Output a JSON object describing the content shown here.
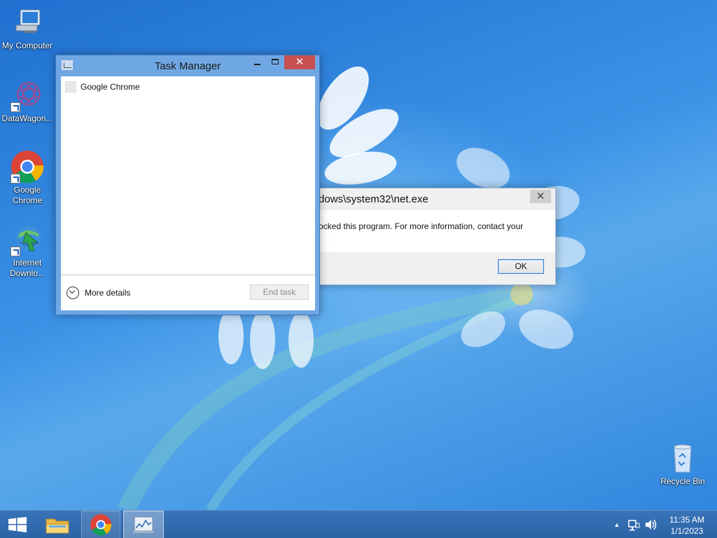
{
  "desktop": {
    "icons": [
      {
        "label": "My Computer"
      },
      {
        "label": "DataWagon..."
      },
      {
        "label": "Google Chrome"
      },
      {
        "label": "Internet Downlo..."
      },
      {
        "label": "Recycle Bin"
      }
    ]
  },
  "error_dialog": {
    "title": "dows\\system32\\net.exe",
    "message": "ocked this program. For more information, contact your",
    "ok_label": "OK",
    "close_glyph": "✕"
  },
  "task_manager": {
    "title": "Task Manager",
    "close_glyph": "✕",
    "processes": [
      {
        "name": "Google Chrome"
      }
    ],
    "more_details_label": "More details",
    "end_task_label": "End task"
  },
  "taskbar": {
    "pinned": [
      "start-button",
      "file-explorer",
      "google-chrome",
      "task-manager"
    ],
    "tray_up_glyph": "▲",
    "clock": {
      "time": "11:35 AM",
      "date": "1/1/2023"
    }
  },
  "colors": {
    "wallpaper": "#2f86dd",
    "taskbar": "#2b63a6",
    "window_frame": "#6fa7e4",
    "close_button": "#c75050"
  }
}
